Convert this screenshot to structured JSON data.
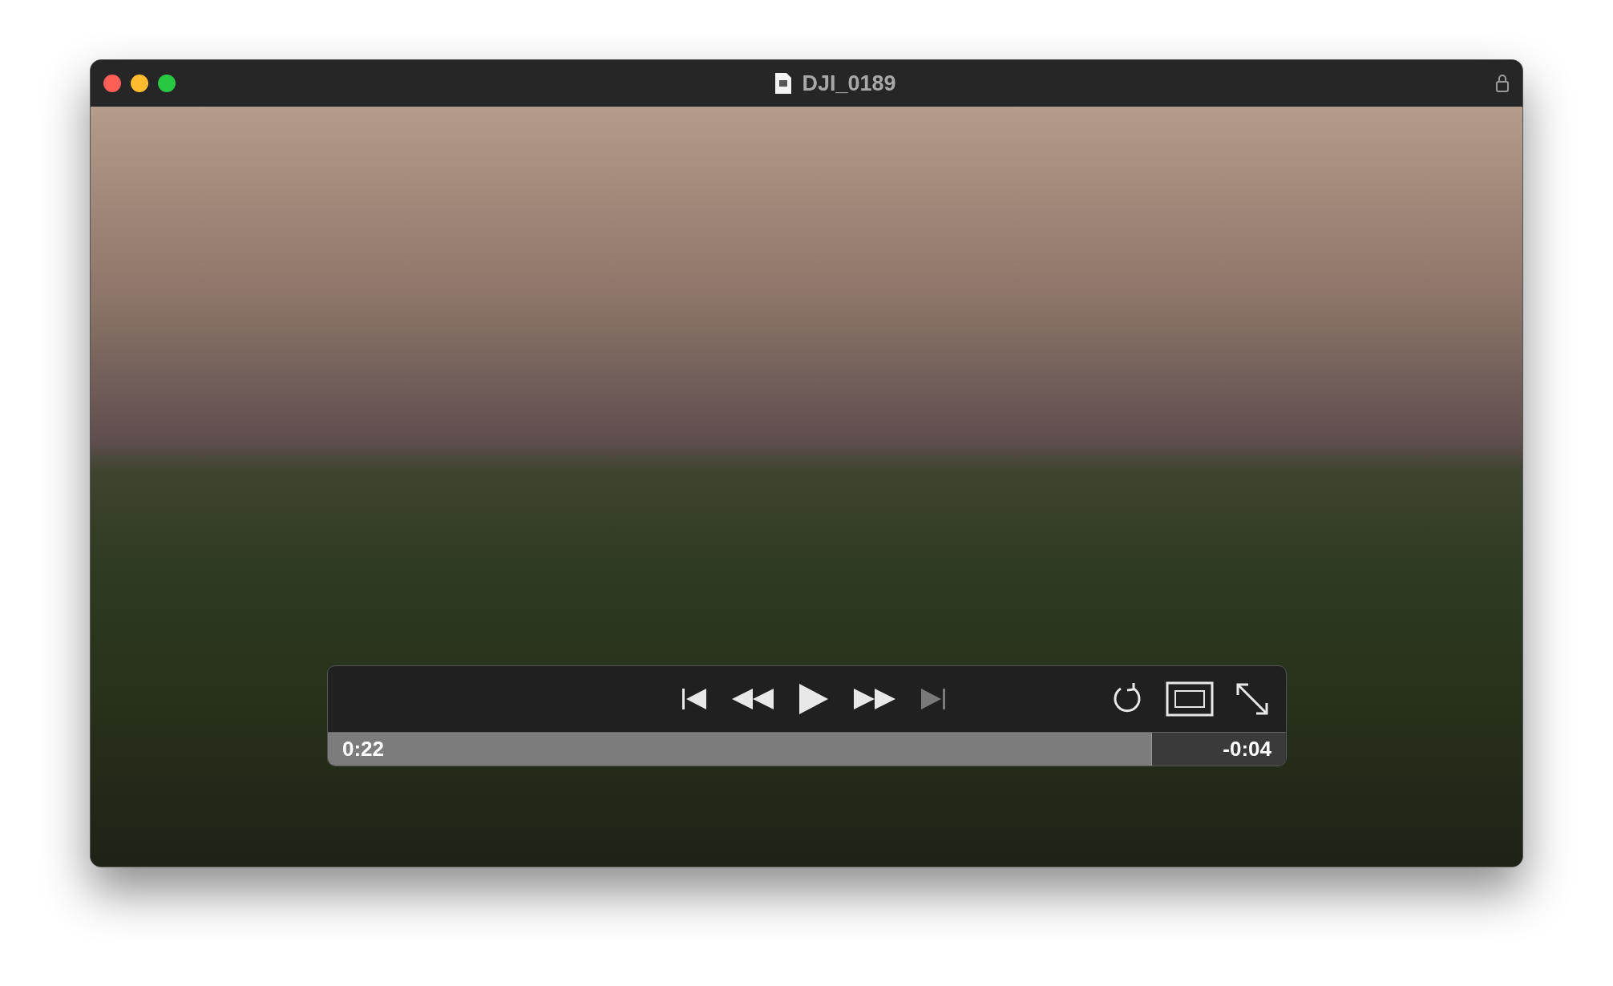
{
  "window": {
    "title": "DJI_0189"
  },
  "controls": {
    "transport": [
      {
        "kind": "skip-start",
        "disabled": false
      },
      {
        "kind": "rewind",
        "disabled": false
      },
      {
        "kind": "play",
        "disabled": false
      },
      {
        "kind": "forward",
        "disabled": false
      },
      {
        "kind": "skip-end",
        "disabled": true
      }
    ],
    "tools": [
      {
        "kind": "loop"
      },
      {
        "kind": "screen"
      },
      {
        "kind": "fullscreen"
      }
    ],
    "progress": {
      "level": 0.86,
      "elapsed": "0:22",
      "remaining": "-0:04"
    }
  }
}
